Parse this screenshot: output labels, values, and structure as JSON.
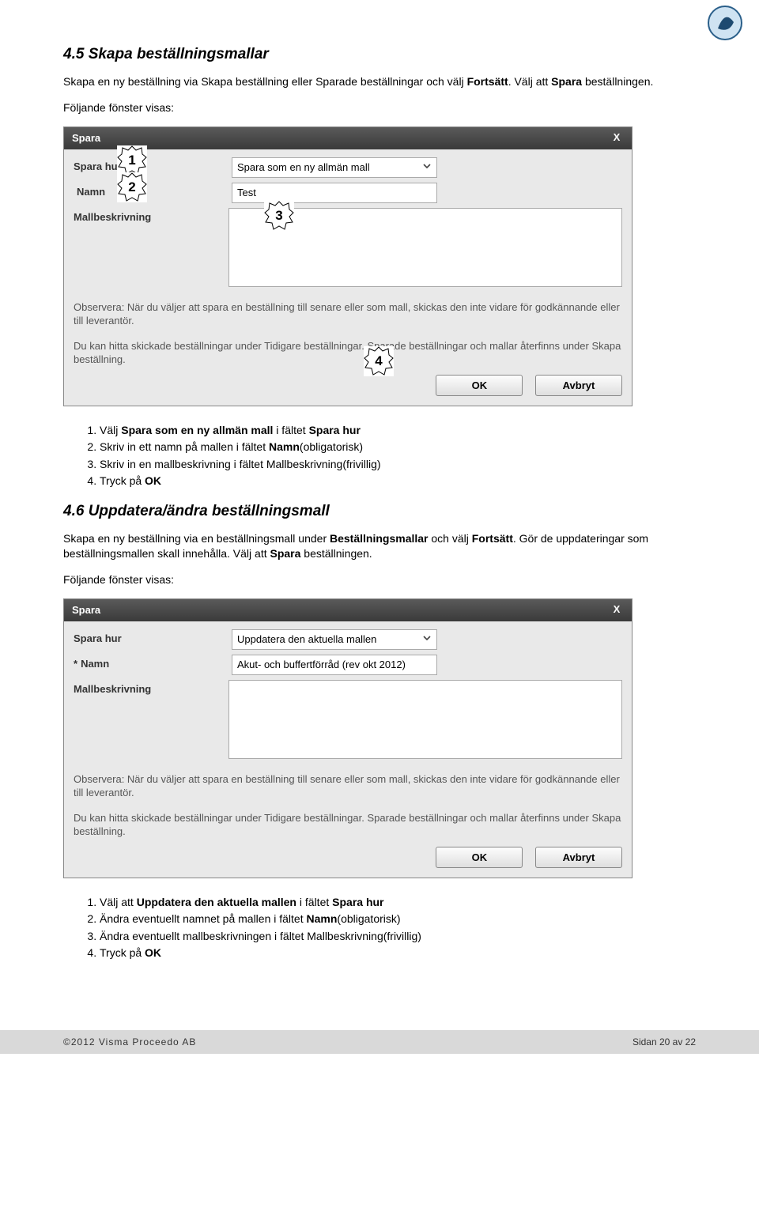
{
  "logo_alt": "Proceedo",
  "section45": {
    "heading": "4.5  Skapa beställningsmallar",
    "intro_html": "Skapa en ny beställning via Skapa beställning eller Sparade beställningar och välj <b>Fortsätt</b>. Välj att <b>Spara</b> beställningen.",
    "following": "Följande fönster visas:"
  },
  "dialog1": {
    "title": "Spara",
    "close": "X",
    "labels": {
      "spara_hur": "Spara hur",
      "namn": "Namn",
      "mallbeskrivning": "Mallbeskrivning"
    },
    "req_marker": "",
    "spara_hur_value": "Spara som en ny allmän mall",
    "namn_value": "Test",
    "note1": "Observera: När du väljer att spara en beställning till senare eller som mall, skickas den inte vidare för godkännande eller till leverantör.",
    "note2": "Du kan hitta skickade beställningar under Tidigare beställningar. Sparade beställningar och mallar återfinns under Skapa beställning.",
    "buttons": {
      "ok": "OK",
      "cancel": "Avbryt"
    }
  },
  "callouts1": {
    "c1": "1",
    "c2": "2",
    "c3": "3",
    "c4": "4"
  },
  "steps45": [
    "Välj <b>Spara som en ny allmän mall</b> i fältet <b>Spara hur</b>",
    "Skriv in ett namn på mallen i fältet <b>Namn</b>(obligatorisk)",
    "Skriv in en mallbeskrivning i fältet Mallbeskrivning(frivillig)",
    "Tryck på <b>OK</b>"
  ],
  "section46": {
    "heading": "4.6  Uppdatera/ändra beställningsmall",
    "intro_html": "Skapa en ny beställning via en beställningsmall under <b>Beställningsmallar</b> och välj <b>Fortsätt</b>. Gör de uppdateringar som beställningsmallen skall innehålla. Välj att <b>Spara</b> beställningen.",
    "following": "Följande fönster visas:"
  },
  "dialog2": {
    "title": "Spara",
    "close": "X",
    "labels": {
      "spara_hur": "Spara hur",
      "namn": "Namn",
      "mallbeskrivning": "Mallbeskrivning"
    },
    "req_marker": "*",
    "spara_hur_value": "Uppdatera den aktuella mallen",
    "namn_value": "Akut- och buffertförråd (rev okt 2012)",
    "note1": "Observera: När du väljer att spara en beställning till senare eller som mall, skickas den inte vidare för godkännande eller till leverantör.",
    "note2": "Du kan hitta skickade beställningar under Tidigare beställningar. Sparade beställningar och mallar återfinns under Skapa beställning.",
    "buttons": {
      "ok": "OK",
      "cancel": "Avbryt"
    }
  },
  "steps46": [
    "Välj att <b>Uppdatera den aktuella mallen</b> i fältet <b>Spara hur</b>",
    "Ändra eventuellt namnet på mallen i fältet <b>Namn</b>(obligatorisk)",
    "Ändra eventuellt mallbeskrivningen i fältet Mallbeskrivning(frivillig)",
    "Tryck på <b>OK</b>"
  ],
  "footer": {
    "left": "©2012 Visma Proceedo AB",
    "right": "Sidan 20 av 22"
  }
}
